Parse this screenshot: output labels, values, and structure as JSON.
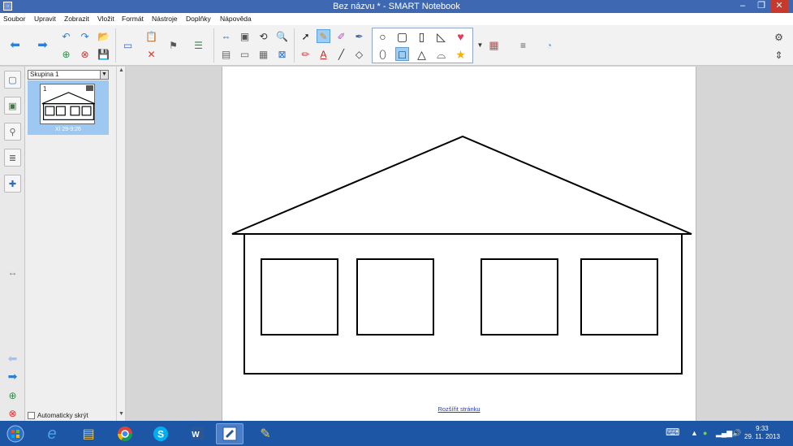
{
  "window": {
    "title": "Bez názvu * - SMART Notebook",
    "controls": {
      "minimize": "–",
      "maximize": "❐",
      "close": "✕"
    }
  },
  "menu": [
    "Soubor",
    "Upravit",
    "Zobrazit",
    "Vložit",
    "Formát",
    "Nástroje",
    "Doplňky",
    "Nápověda"
  ],
  "sorter": {
    "group_label": "Skupina 1",
    "page_number": "1",
    "page_timestamp": "Xl 29-9:26",
    "auto_hide_label": "Automaticky skrýt"
  },
  "canvas": {
    "extend_page_link": "Rozšířit stránku"
  },
  "toolbar": {
    "icons": [
      "previous-page",
      "next-page",
      "undo",
      "redo",
      "add-page",
      "delete-page",
      "open",
      "save",
      "screen-shade",
      "paste",
      "delete",
      "document-camera",
      "table",
      "full-screen",
      "select",
      "pen",
      "creative-pen",
      "magic-pen",
      "eraser",
      "text",
      "line",
      "shapes",
      "fill",
      "properties",
      "add-ons"
    ],
    "selected_shape": "rectangle"
  },
  "taskbar": {
    "apps": [
      "start",
      "internet-explorer",
      "file-explorer",
      "chrome",
      "skype",
      "word",
      "smart-notebook",
      "paint"
    ],
    "time": "9:33",
    "date": "29. 11. 2013"
  },
  "colors": {
    "titlebar": "#3e68b1",
    "close_button": "#c7392b",
    "taskbar": "#1d56a5",
    "selection": "#9ccdf4"
  }
}
